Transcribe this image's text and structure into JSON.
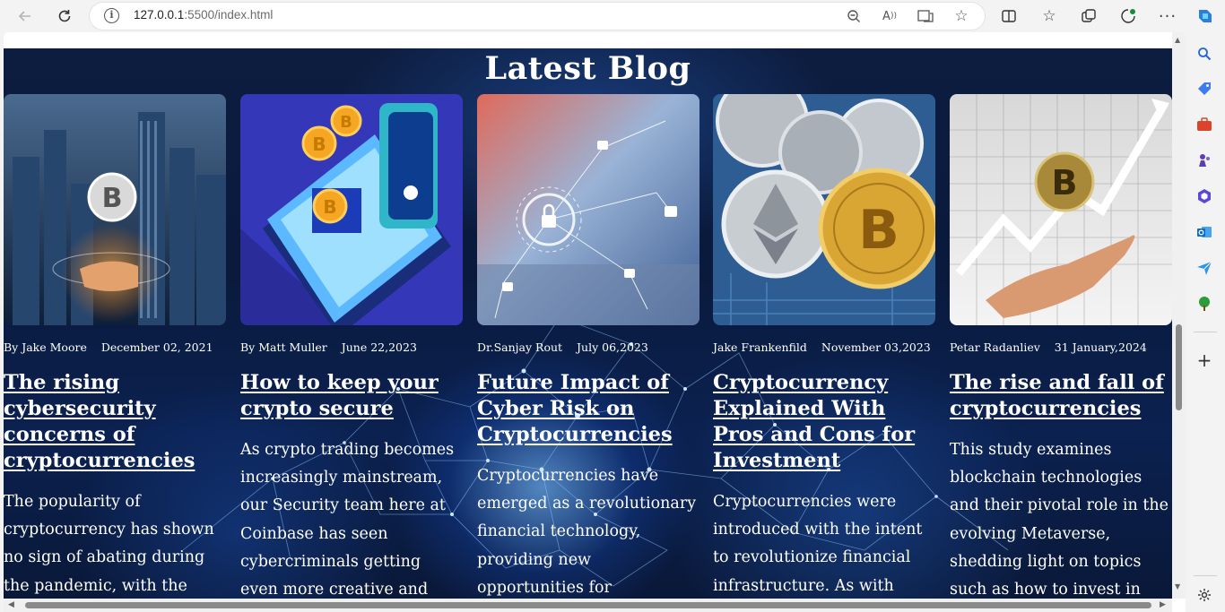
{
  "browser": {
    "url_host": "127.0.0.1",
    "url_rest": ":5500/index.html"
  },
  "page": {
    "heading": "Latest Blog",
    "cards": [
      {
        "author": "By Jake Moore",
        "date": "December 02, 2021",
        "title": "The rising cybersecurity concerns of cryptocurrencies",
        "excerpt": "The popularity of cryptocurrency has shown no sign of abating during the pandemic, with the total"
      },
      {
        "author": "By Matt Muller",
        "date": "June 22,2023",
        "title": "How to keep your crypto secure",
        "excerpt": "As crypto trading becomes increasingly mainstream, our Security team here at Coinbase has seen cybercriminals getting even more creative and persistent"
      },
      {
        "author": "Dr.Sanjay Rout",
        "date": "July 06,2023",
        "title": "Future Impact of Cyber Risk on Cryptocurrencies",
        "excerpt": "Cryptocurrencies have emerged as a revolutionary financial technology, providing new opportunities for decentralized"
      },
      {
        "author": "Jake Frankenfild",
        "date": "November 03,2023",
        "title": "Cryptocurrency Explained With Pros and Cons for Investment",
        "excerpt": "Cryptocurrencies were introduced with the intent to revolutionize financial infrastructure. As with every"
      },
      {
        "author": "Petar Radanliev",
        "date": "31 January,2024",
        "title": "The rise and fall of cryptocurrencies",
        "excerpt": "This study examines blockchain technologies and their pivotal role in the evolving Metaverse, shedding light on topics such as how to invest in"
      }
    ]
  }
}
